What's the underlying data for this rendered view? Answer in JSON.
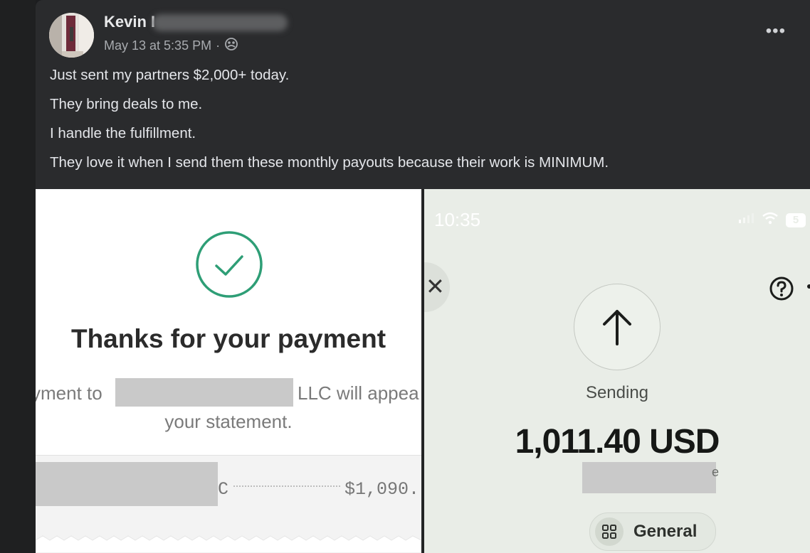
{
  "post": {
    "author": "Kevin I",
    "timestamp": "May 13 at 5:35 PM",
    "separator": "·",
    "more_icon": "more-horizontal-icon",
    "privacy_icon": "group-audience-icon",
    "lines": [
      "Just sent my partners $2,000+ today.",
      "They bring deals to me.",
      "I handle the fulfillment.",
      "They love it when I send them these monthly payouts because their work is MINIMUM."
    ]
  },
  "receipt_screenshot": {
    "title": "Thanks for your payment",
    "payment_prefix": "yment to",
    "payment_suffix": "LLC will appea",
    "statement": "your statement.",
    "row_letter": "C",
    "row_amount": "$1,090.",
    "check_color": "#2e9e76"
  },
  "transfer_screenshot": {
    "time": "10:35",
    "battery": "5",
    "status_label": "Sending",
    "amount": "1,011.40 USD",
    "stray_char": "e",
    "category": "General"
  }
}
